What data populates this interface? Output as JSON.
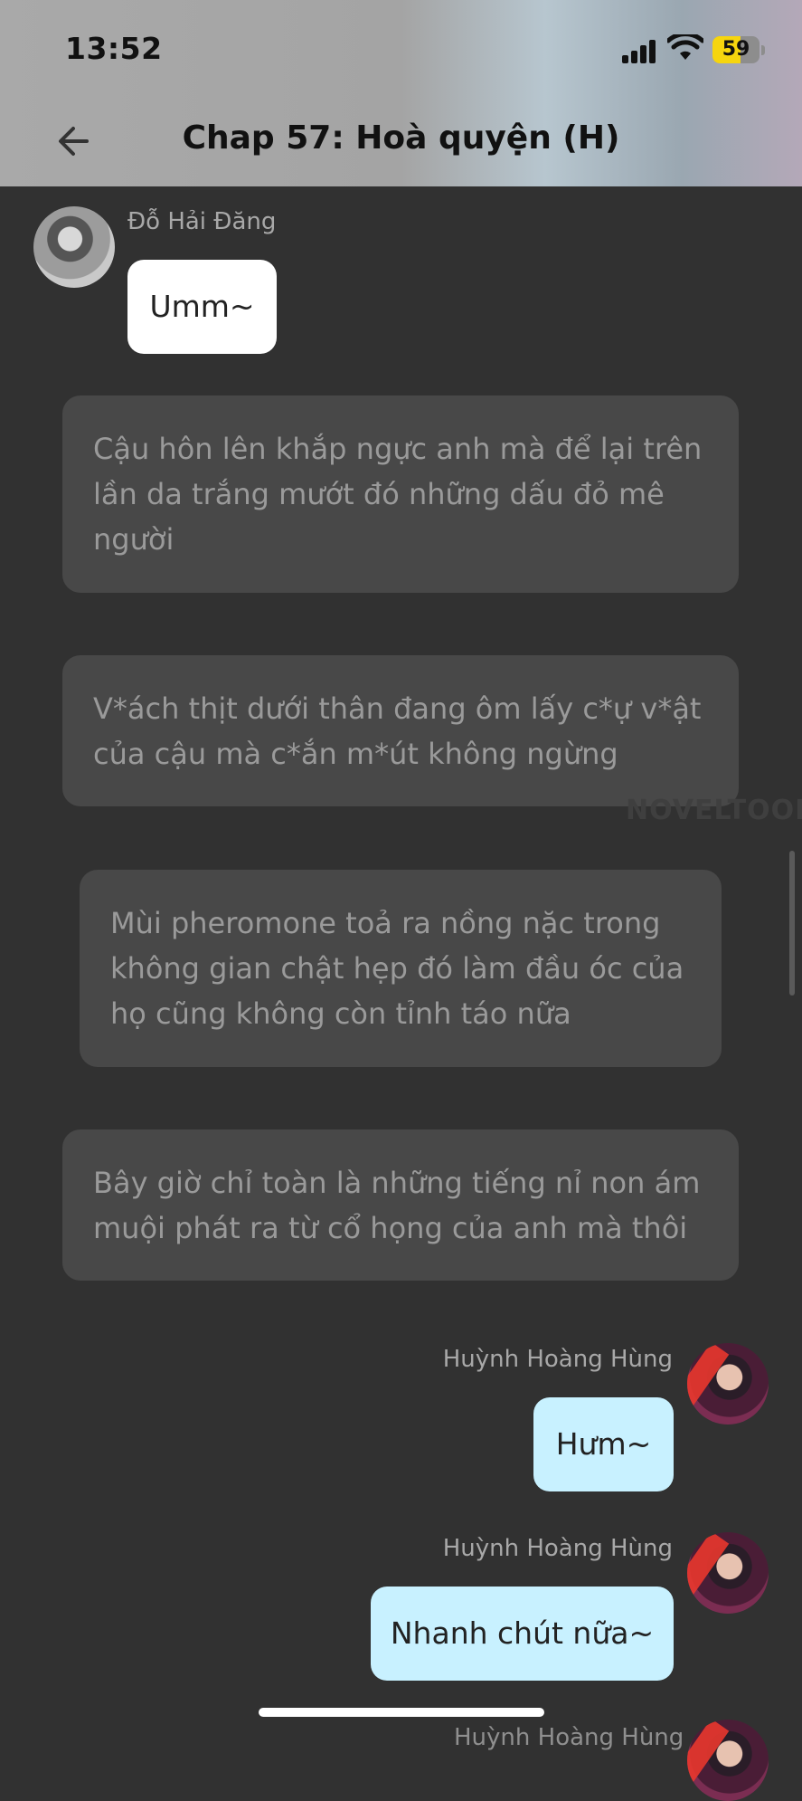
{
  "status_bar": {
    "time": "13:52",
    "battery": "59",
    "battery_level": 0.59
  },
  "header": {
    "back_icon": "arrow-left-icon",
    "title": "Chap 57: Hoà quyện (H)"
  },
  "messages": [
    {
      "speaker": "Đỗ Hải Đăng",
      "text": "Umm~",
      "side": "left",
      "style": "white"
    },
    {
      "narration": "Cậu hôn lên khắp ngực anh mà để lại trên lần da trắng mướt đó những dấu đỏ mê người"
    },
    {
      "narration": "V*ách thịt dưới thân đang ôm lấy c*ự v*ật của cậu mà c*ắn m*út không ngừng"
    },
    {
      "narration": "Mùi pheromone toả ra nồng nặc trong không gian chật hẹp đó làm đầu óc của họ cũng không còn tỉnh táo nữa"
    },
    {
      "narration": "Bây giờ chỉ toàn là những tiếng nỉ non ám muội phát ra từ cổ họng của anh mà thôi"
    },
    {
      "speaker": "Huỳnh Hoàng Hùng",
      "text": "Hưm~",
      "side": "right",
      "style": "blue"
    },
    {
      "speaker": "Huỳnh Hoàng Hùng",
      "text": "Nhanh chút nữa~",
      "side": "right",
      "style": "blue"
    },
    {
      "speaker": "Huỳnh Hoàng Hùng",
      "side": "right"
    }
  ],
  "watermark": "NOVELTOON",
  "colors": {
    "bubble_blue": "#c8f1ff",
    "narration_bg": "#484848",
    "background": "#313131"
  }
}
